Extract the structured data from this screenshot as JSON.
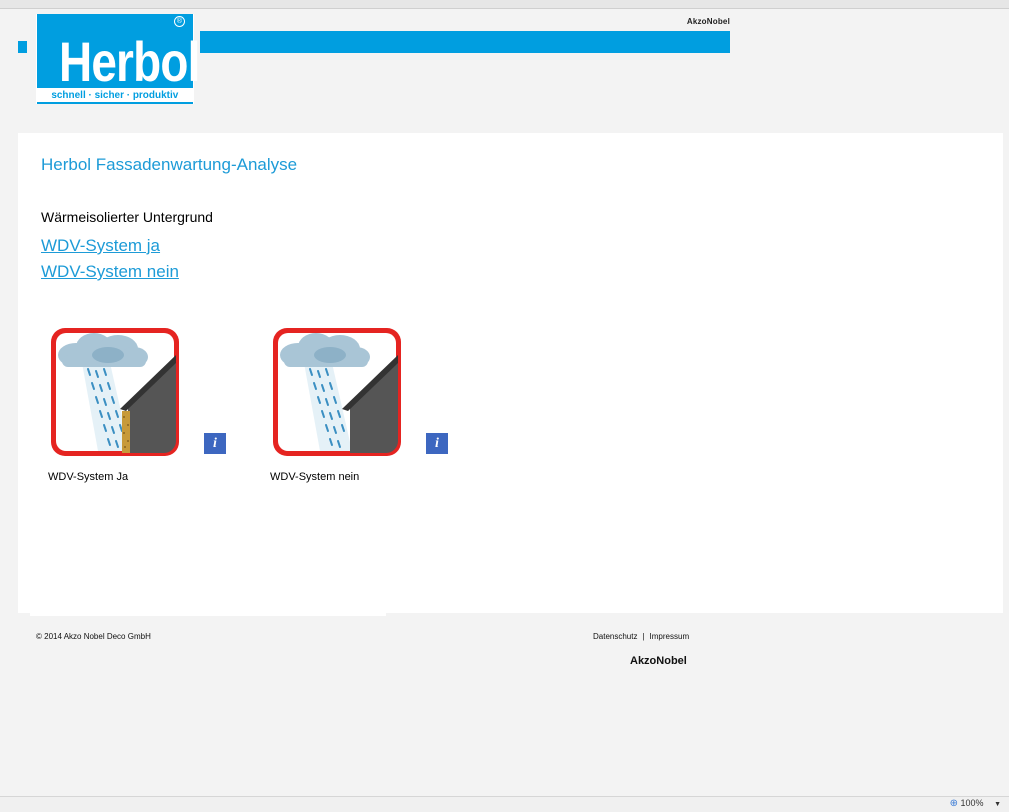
{
  "header": {
    "brand_word": "Herbol",
    "brand_tagline": "schnell · sicher · produktiv",
    "registered_mark": "®",
    "corporate_brand": "AkzoNobel"
  },
  "content": {
    "title": "Herbol Fassadenwartung-Analyse",
    "section_label": "Wärmeisolierter Untergrund",
    "links": [
      "WDV-System ja",
      "WDV-System nein"
    ],
    "tiles": [
      {
        "caption": "WDV-System Ja",
        "info_label": "i",
        "icon": "rain-facade-insulated-icon"
      },
      {
        "caption": "WDV-System nein",
        "info_label": "i",
        "icon": "rain-facade-icon"
      }
    ]
  },
  "footer": {
    "copyright": "© 2014 Akzo Nobel Deco GmbH",
    "link_privacy": "Datenschutz",
    "separator": "|",
    "link_imprint": "Impressum",
    "corporate_brand": "AkzoNobel"
  },
  "statusbar": {
    "zoom": "100%"
  },
  "colors": {
    "brand_blue": "#009ee0",
    "link_blue": "#1d9bd7",
    "frame_red": "#e52421",
    "info_blue": "#3d67c0"
  }
}
